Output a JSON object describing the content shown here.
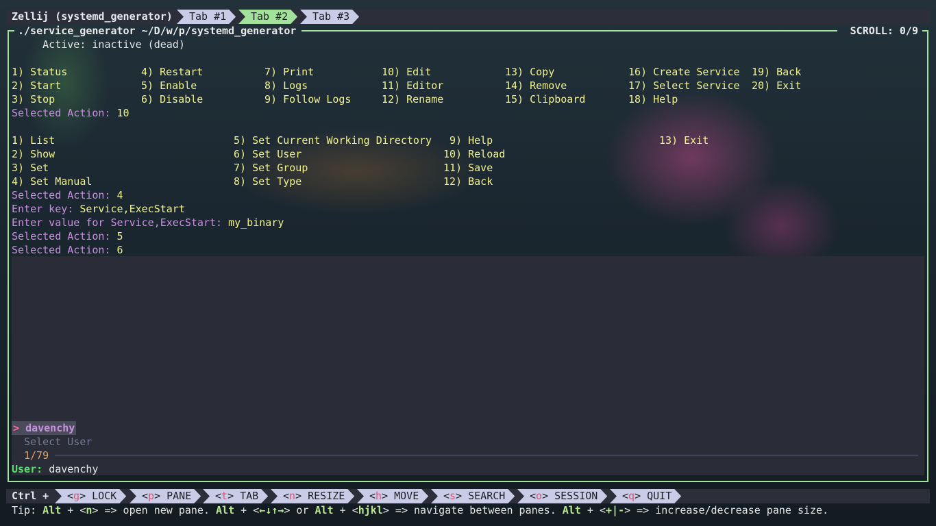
{
  "tabbar": {
    "session": "Zellij (systemd_generator)",
    "tabs": [
      {
        "label": "Tab #1",
        "active": false
      },
      {
        "label": "Tab #2",
        "active": true
      },
      {
        "label": "Tab #3",
        "active": false
      }
    ]
  },
  "pane": {
    "title": "./service_generator ~/D/w/p/systemd_generator",
    "scroll_label": "SCROLL:",
    "scroll_value": "0/9"
  },
  "terminal": {
    "active_line": "     Active: inactive (dead)",
    "main_menu": [
      {
        "text": "1) Status"
      },
      {
        "text": "4) Restart"
      },
      {
        "text": "7) Print"
      },
      {
        "text": "10) Edit"
      },
      {
        "text": "13) Copy"
      },
      {
        "text": "16) Create Service"
      },
      {
        "text": "19) Back"
      },
      {
        "text": "2) Start"
      },
      {
        "text": "5) Enable"
      },
      {
        "text": "8) Logs"
      },
      {
        "text": "11) Editor"
      },
      {
        "text": "14) Remove"
      },
      {
        "text": "17) Select Service"
      },
      {
        "text": "20) Exit"
      },
      {
        "text": "3) Stop"
      },
      {
        "text": "6) Disable"
      },
      {
        "text": "9) Follow Logs"
      },
      {
        "text": "12) Rename"
      },
      {
        "text": "15) Clipboard"
      },
      {
        "text": "18) Help"
      }
    ],
    "selected_action_label": "Selected Action:",
    "selected_action_1": "10",
    "edit_menu": [
      {
        "text": "1) List"
      },
      {
        "text": "5) Set Current Working Directory"
      },
      {
        "text": "9) Help"
      },
      {
        "text": "13) Exit"
      },
      {
        "text": "2) Show"
      },
      {
        "text": "6) Set User"
      },
      {
        "text": "10) Reload"
      },
      {
        "text": "3) Set"
      },
      {
        "text": "7) Set Group"
      },
      {
        "text": "11) Save"
      },
      {
        "text": "4) Set Manual"
      },
      {
        "text": "8) Set Type"
      },
      {
        "text": "12) Back"
      }
    ],
    "selected_action_2": "4",
    "enter_key_label": "Enter key:",
    "enter_key_value": "Service,ExecStart",
    "enter_value_label": "Enter value for Service,ExecStart:",
    "enter_value_value": "my_binary",
    "selected_action_3": "5",
    "selected_action_4": "6"
  },
  "picker": {
    "pointer": ">",
    "selected_item": "davenchy",
    "header": "Select User",
    "count": "1/79",
    "user_label": "User:",
    "user_value": "davenchy"
  },
  "statusbar": {
    "ctrl_label": "Ctrl +",
    "keys": [
      {
        "key": "g",
        "label": "LOCK"
      },
      {
        "key": "p",
        "label": "PANE"
      },
      {
        "key": "t",
        "label": "TAB"
      },
      {
        "key": "n",
        "label": "RESIZE"
      },
      {
        "key": "h",
        "label": "MOVE"
      },
      {
        "key": "s",
        "label": "SEARCH"
      },
      {
        "key": "o",
        "label": "SESSION"
      },
      {
        "key": "q",
        "label": "QUIT"
      }
    ],
    "tip": {
      "t1": "Tip: ",
      "alt": "Alt",
      "t2": " + <",
      "n": "n",
      "t3": "> => open new pane. ",
      "t4": " + <",
      "arrows": "←↓↑→",
      "t5": "> or ",
      "t6": " + <",
      "hjkl": "hjkl",
      "t7": "> => navigate between panes. ",
      "t8": " + <",
      "plusminus": "+|-",
      "t9": "> => increase/decrease pane size."
    }
  },
  "colors": {
    "pane_border": "#a3e29b",
    "tab_active": "#a3e29b",
    "tab_inactive": "#c9cce6",
    "menu_text": "#f1f28c",
    "prompt_text": "#c98fe0",
    "user_label": "#56e36a"
  }
}
